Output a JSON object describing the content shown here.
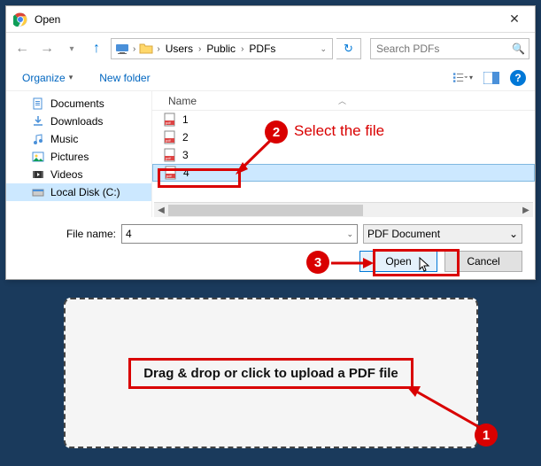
{
  "dialog": {
    "title": "Open",
    "breadcrumb": [
      "Users",
      "Public",
      "PDFs"
    ],
    "search_placeholder": "Search PDFs",
    "organize_label": "Organize",
    "newfolder_label": "New folder",
    "sidebar": [
      {
        "label": "Documents",
        "icon": "documents"
      },
      {
        "label": "Downloads",
        "icon": "downloads"
      },
      {
        "label": "Music",
        "icon": "music"
      },
      {
        "label": "Pictures",
        "icon": "pictures"
      },
      {
        "label": "Videos",
        "icon": "videos"
      },
      {
        "label": "Local Disk (C:)",
        "icon": "disk",
        "selected": true
      }
    ],
    "column_header": "Name",
    "files": [
      {
        "name": "1"
      },
      {
        "name": "2"
      },
      {
        "name": "3"
      },
      {
        "name": "4",
        "selected": true
      }
    ],
    "filename_label": "File name:",
    "filename_value": "4",
    "filetype_value": "PDF Document",
    "open_label": "Open",
    "cancel_label": "Cancel"
  },
  "annotations": {
    "m1": "1",
    "m2": "2",
    "m3": "3",
    "text2": "Select the file"
  },
  "dropzone": {
    "text": "Drag & drop or click to upload a PDF file"
  }
}
